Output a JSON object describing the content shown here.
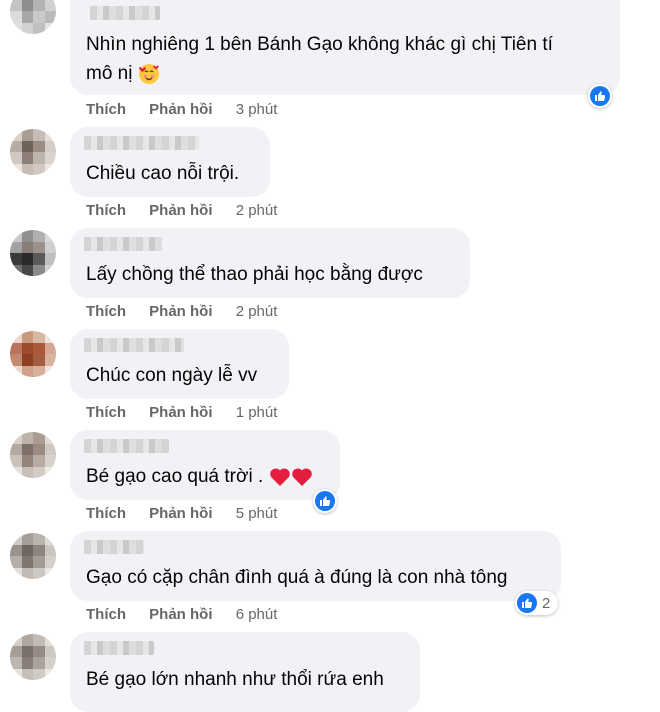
{
  "comments": [
    {
      "text_lines": [
        "Nhìn nghiêng 1 bên Bánh Gạo không khác gì chị Tiên tí",
        "mô nị"
      ],
      "emoji": "smiling-face-with-hearts",
      "like_label": "Thích",
      "reply_label": "Phản hồi",
      "time": "3 phút",
      "reactions": {
        "icon": "like-icon"
      }
    },
    {
      "text_lines": [
        "Chiều cao nỗi trội."
      ],
      "like_label": "Thích",
      "reply_label": "Phản hồi",
      "time": "2 phút"
    },
    {
      "text_lines": [
        "Lấy chồng thể thao phải học bằng được"
      ],
      "like_label": "Thích",
      "reply_label": "Phản hồi",
      "time": "2 phút"
    },
    {
      "text_lines": [
        "Chúc con ngày lễ vv"
      ],
      "like_label": "Thích",
      "reply_label": "Phản hồi",
      "time": "1 phút"
    },
    {
      "text_lines": [
        "Bé gạo cao quá trời ."
      ],
      "emoji": "two-red-hearts",
      "like_label": "Thích",
      "reply_label": "Phản hồi",
      "time": "5 phút",
      "reactions": {
        "icon": "like-icon"
      }
    },
    {
      "text_lines": [
        "Gạo có cặp chân đình quá à đúng là con nhà tông"
      ],
      "like_label": "Thích",
      "reply_label": "Phản hồi",
      "time": "6 phút",
      "reactions": {
        "icon": "like-icon",
        "count": "2"
      }
    },
    {
      "text_lines": [
        "Bé gạo lớn nhanh như thổi rứa enh"
      ]
    }
  ],
  "colors": {
    "bubble": "#f0f2f5",
    "action_text": "#65676b",
    "like_blue": "#1877f2",
    "heart_red": "#e41e3f"
  }
}
